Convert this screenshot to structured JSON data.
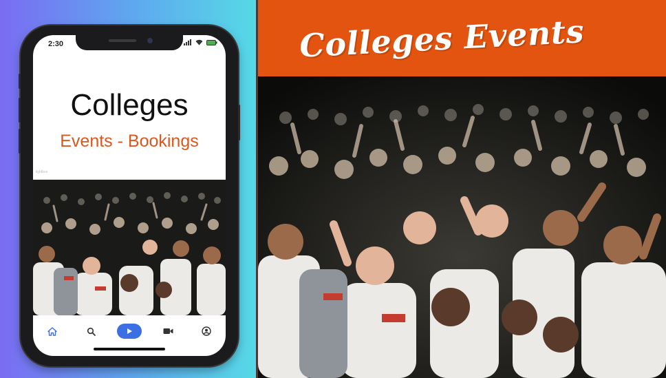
{
  "banner": {
    "title": "Colleges Events"
  },
  "phone": {
    "status_time": "2:30",
    "app_title": "Colleges",
    "app_subtitle": "Events - Bookings",
    "tiny_label": "lightbox",
    "nav": [
      {
        "icon": "home-icon",
        "active": true
      },
      {
        "icon": "search-icon"
      },
      {
        "icon": "play-icon"
      },
      {
        "icon": "video-camera-icon"
      },
      {
        "icon": "account-icon"
      }
    ]
  },
  "colors": {
    "banner_bg": "#e25410",
    "subtitle": "#d9581e",
    "nav_accent": "#3b6fe3",
    "gradient_left": "#7a6cf2",
    "gradient_right": "#56d9e6"
  }
}
